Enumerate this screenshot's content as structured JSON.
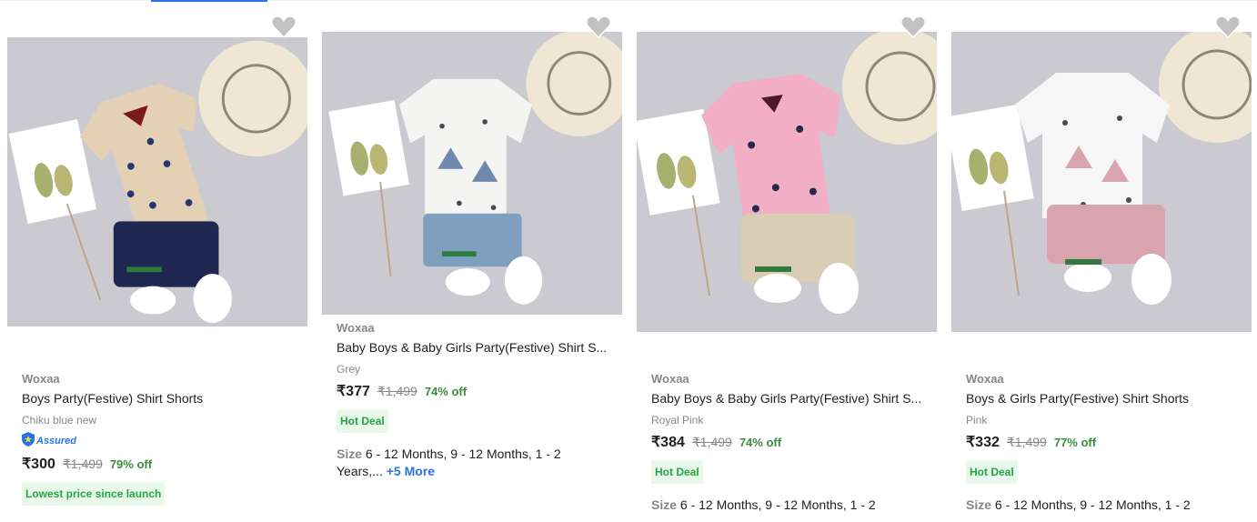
{
  "products": [
    {
      "brand": "Woxaa",
      "title": "Boys Party(Festive) Shirt Shorts",
      "variant": "Chiku blue new",
      "assured": "Assured",
      "price": "₹300",
      "mrp": "₹1,499",
      "discount": "79% off",
      "badge": "Lowest price since launch",
      "shirt_color": "#e4d0b4",
      "shorts_color": "#1f2650"
    },
    {
      "brand": "Woxaa",
      "title": "Baby Boys & Baby Girls Party(Festive) Shirt S...",
      "variant": "Grey",
      "price": "₹377",
      "mrp": "₹1,499",
      "discount": "74% off",
      "badge": "Hot Deal",
      "size_label": "Size",
      "size_values": "6 - 12 Months, 9 - 12 Months, 1 - 2 Years,...",
      "more": "+5 More",
      "shirt_color": "#f4f4f2",
      "shorts_color": "#7f9fbf"
    },
    {
      "brand": "Woxaa",
      "title": "Baby Boys & Baby Girls Party(Festive) Shirt S...",
      "variant": "Royal Pink",
      "price": "₹384",
      "mrp": "₹1,499",
      "discount": "74% off",
      "badge": "Hot Deal",
      "size_label": "Size",
      "size_values": "6 - 12 Months, 9 - 12 Months, 1 - 2",
      "shirt_color": "#f2aec4",
      "shorts_color": "#d9cdb6"
    },
    {
      "brand": "Woxaa",
      "title": "Boys & Girls Party(Festive) Shirt Shorts",
      "variant": "Pink",
      "price": "₹332",
      "mrp": "₹1,499",
      "discount": "77% off",
      "badge": "Hot Deal",
      "size_label": "Size",
      "size_values": "6 - 12 Months, 9 - 12 Months, 1 - 2",
      "shirt_color": "#f6f6f6",
      "shorts_color": "#d9a4ad"
    }
  ],
  "icons": {
    "wishlist": "heart-icon",
    "assured": "assured-shield-icon"
  },
  "colors": {
    "accent": "#2874f0",
    "discount": "#388e3c",
    "deal_badge_bg": "#e8f8ea",
    "deal_badge_text": "#26a541"
  }
}
